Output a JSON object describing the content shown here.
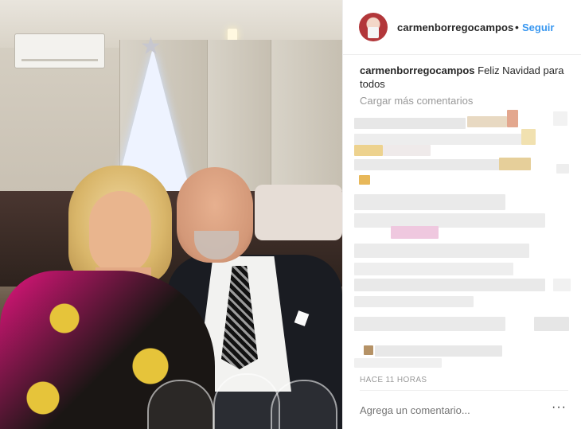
{
  "post": {
    "username": "carmenborregocampos",
    "dot": "•",
    "follow_label": "Seguir",
    "caption_username": "carmenborregocampos",
    "caption_text": "Feliz Navidad para todos",
    "load_more_label": "Cargar más comentarios",
    "timestamp": "HACE 11 HORAS",
    "comment_placeholder": "Agrega un comentario...",
    "more_label": "···"
  },
  "colors": {
    "link": "#3897f0",
    "text": "#262626",
    "muted": "#999999",
    "border": "#efefef"
  },
  "icons": {
    "more": "more-options-icon"
  }
}
